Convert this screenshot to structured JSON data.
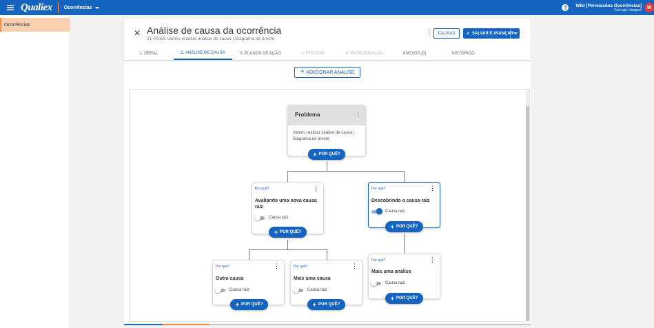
{
  "topbar": {
    "logo": "Qualiex",
    "module": "Ocorrências",
    "user_name": "Wiki [Permissões Ocorrências]",
    "user_org": "ForLogic Hangout",
    "avatar_initial": "W",
    "brand_color": "#1565c0",
    "accent_color": "#ff8a3d"
  },
  "sidebar": {
    "items": [
      {
        "label": "Ocorrências"
      }
    ]
  },
  "header": {
    "title": "Análise de causa da ocorrência",
    "subtitle": "21-00058 Vamos realizar análise de causa | Diagrama de árvore",
    "causas_label": "CAUSAS",
    "save_label": "SALVAR E AVANÇAR"
  },
  "tabs": [
    {
      "label": "1. GERAL",
      "state": "normal"
    },
    {
      "label": "2. ANÁLISE DE CAUSA",
      "state": "active"
    },
    {
      "label": "3. PLANOS DE AÇÃO",
      "state": "normal"
    },
    {
      "label": "4. EFICÁCIA",
      "state": "disabled"
    },
    {
      "label": "5. PADRONIZAÇÃO",
      "state": "disabled"
    },
    {
      "label": "ANEXOS (0)",
      "state": "normal"
    },
    {
      "label": "HISTÓRICO",
      "state": "normal"
    }
  ],
  "content": {
    "add_analysis_label": "ADICIONAR ANÁLISE"
  },
  "tree": {
    "problem": {
      "title": "Problema",
      "description": "Vamos realizar análise de causa | Diagrama de árvore"
    },
    "why_button_label": "POR QUÊ?",
    "why_label": "Por quê?",
    "root_cause_label": "Causa raiz",
    "nodes": [
      {
        "text": "Avaliando uma nova causa raiz",
        "root_cause": false
      },
      {
        "text": "Descobrindo a causa raiz",
        "root_cause": true
      },
      {
        "text": "Outra causa",
        "root_cause": false
      },
      {
        "text": "Mais uma causa",
        "root_cause": false
      },
      {
        "text": "Mais uma análise",
        "root_cause": false
      }
    ]
  }
}
